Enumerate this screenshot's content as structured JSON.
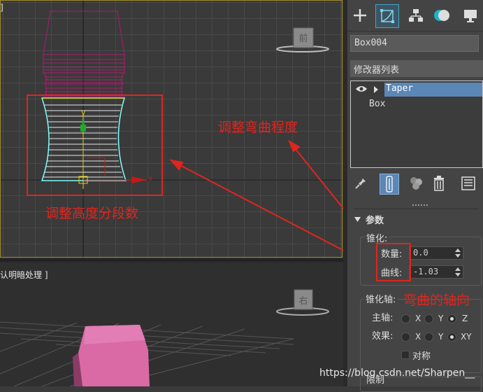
{
  "viewport_front": {
    "corner_label": "]",
    "viewcube_face": "前",
    "annotations": {
      "segments": "调整高度分段数",
      "curve": "调整弯曲程度"
    },
    "axis_y": "y",
    "axis_x": "x"
  },
  "viewport_perspective": {
    "label": "认明暗处理 ]",
    "viewcube_face": "右"
  },
  "panel": {
    "tabs": [
      "create-icon",
      "modify-icon",
      "hierarchy-icon",
      "motion-icon",
      "display-icon"
    ],
    "object_name": "Box004",
    "modifier_list_label": "修改器列表",
    "stack": {
      "taper": "Taper",
      "box": "Box"
    },
    "rollout_title": "参数",
    "taper_group": "锥化:",
    "amount_label": "数量:",
    "amount_value": "0.0",
    "curve_label": "曲线:",
    "curve_value": "-1.03",
    "taper_axis_label": "锥化轴:",
    "taper_axis_annotation": "弯曲的轴向",
    "primary_label": "主轴:",
    "effect_label": "效果:",
    "primary_options": [
      "X",
      "Y",
      "Z"
    ],
    "primary_selected": "Z",
    "effect_options": [
      "X",
      "Y",
      "XY"
    ],
    "effect_selected": "XY",
    "symmetry_label": "对称",
    "limit_label": "限制"
  },
  "watermark": "https://blog.csdn.net/Sharpen__",
  "colors": {
    "annotation_red": "#e0251f",
    "selection_cyan": "#7fffff",
    "modifier_magenta": "#b0196f",
    "stack_highlight": "#5b87b7",
    "box_pink": "#d96aa6"
  }
}
